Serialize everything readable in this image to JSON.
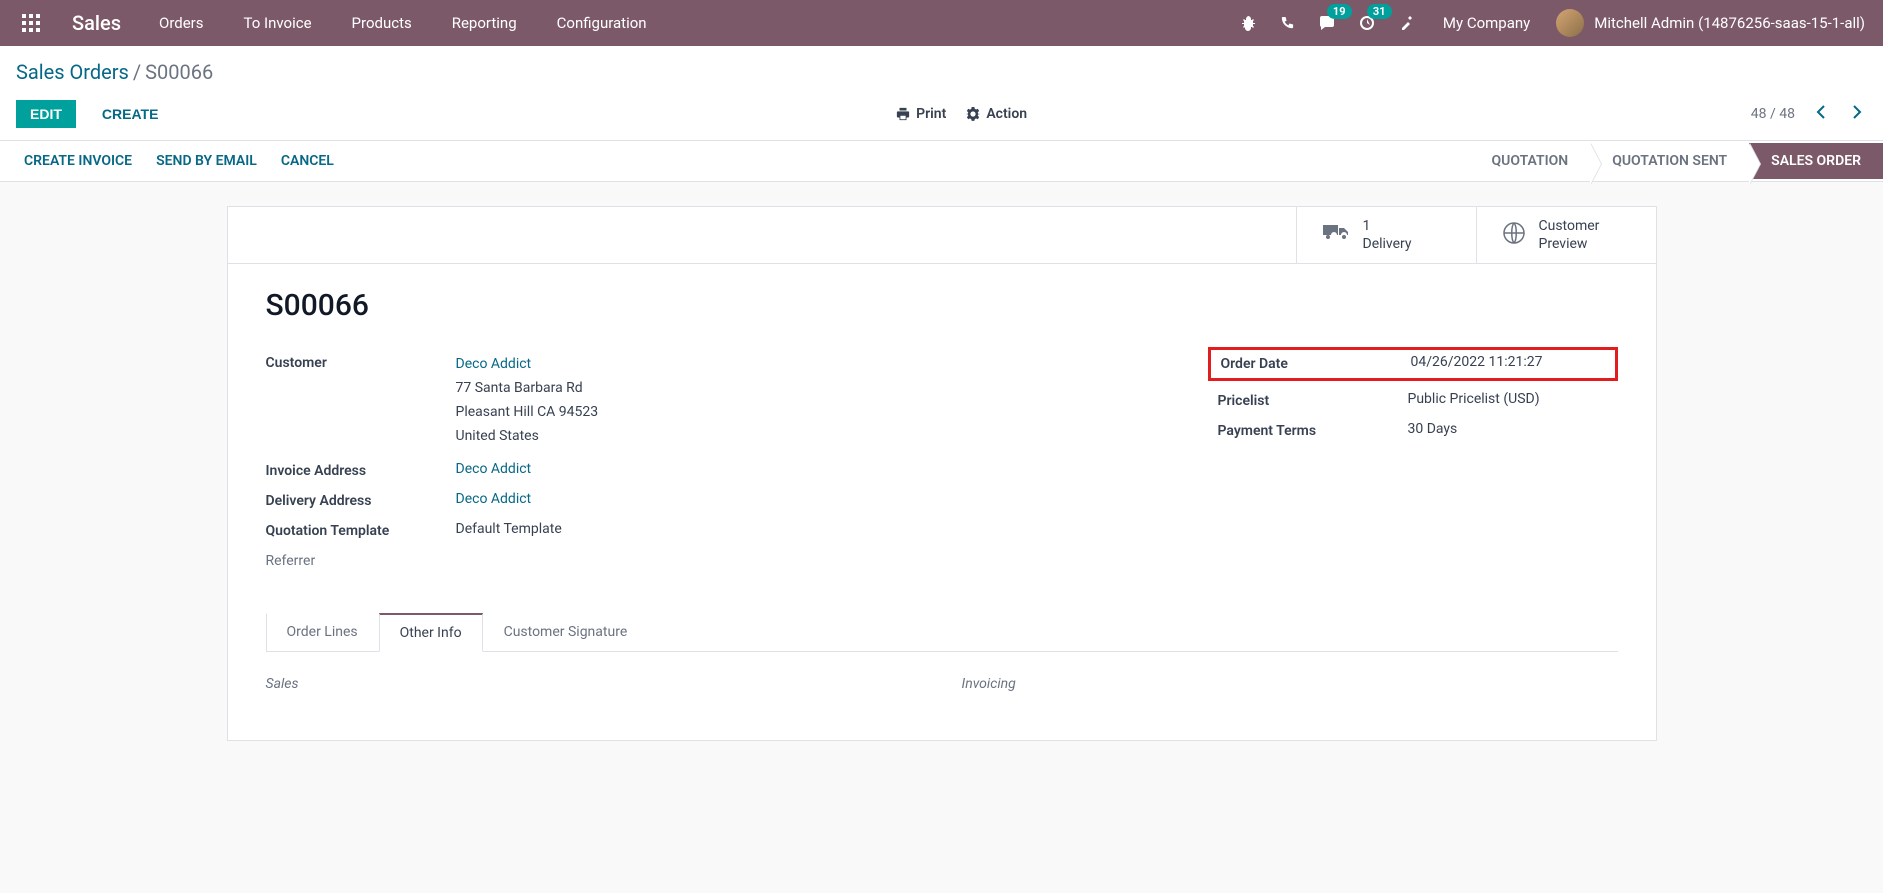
{
  "navbar": {
    "app_name": "Sales",
    "menu": [
      "Orders",
      "To Invoice",
      "Products",
      "Reporting",
      "Configuration"
    ],
    "messaging_badge": "19",
    "activities_badge": "31",
    "company": "My Company",
    "user": "Mitchell Admin (14876256-saas-15-1-all)"
  },
  "breadcrumb": {
    "root": "Sales Orders",
    "sep": "/",
    "current": "S00066"
  },
  "buttons": {
    "edit": "EDIT",
    "create": "CREATE",
    "print": "Print",
    "action": "Action",
    "create_invoice": "CREATE INVOICE",
    "send_by_email": "SEND BY EMAIL",
    "cancel": "CANCEL"
  },
  "pager": {
    "text": "48 / 48"
  },
  "status": {
    "quotation": "QUOTATION",
    "quotation_sent": "QUOTATION SENT",
    "sales_order": "SALES ORDER"
  },
  "stat_buttons": {
    "delivery_count": "1",
    "delivery_label": "Delivery",
    "preview_label1": "Customer",
    "preview_label2": "Preview"
  },
  "order": {
    "name": "S00066",
    "labels": {
      "customer": "Customer",
      "invoice_address": "Invoice Address",
      "delivery_address": "Delivery Address",
      "quotation_template": "Quotation Template",
      "referrer": "Referrer",
      "order_date": "Order Date",
      "pricelist": "Pricelist",
      "payment_terms": "Payment Terms"
    },
    "customer_name": "Deco Addict",
    "customer_address_l1": "77 Santa Barbara Rd",
    "customer_address_l2": "Pleasant Hill CA 94523",
    "customer_address_l3": "United States",
    "invoice_address": "Deco Addict",
    "delivery_address": "Deco Addict",
    "quotation_template": "Default Template",
    "referrer": "",
    "order_date": "04/26/2022 11:21:27",
    "pricelist": "Public Pricelist (USD)",
    "payment_terms": "30 Days"
  },
  "tabs": {
    "order_lines": "Order Lines",
    "other_info": "Other Info",
    "customer_signature": "Customer Signature"
  },
  "tab_sections": {
    "sales": "Sales",
    "invoicing": "Invoicing"
  }
}
